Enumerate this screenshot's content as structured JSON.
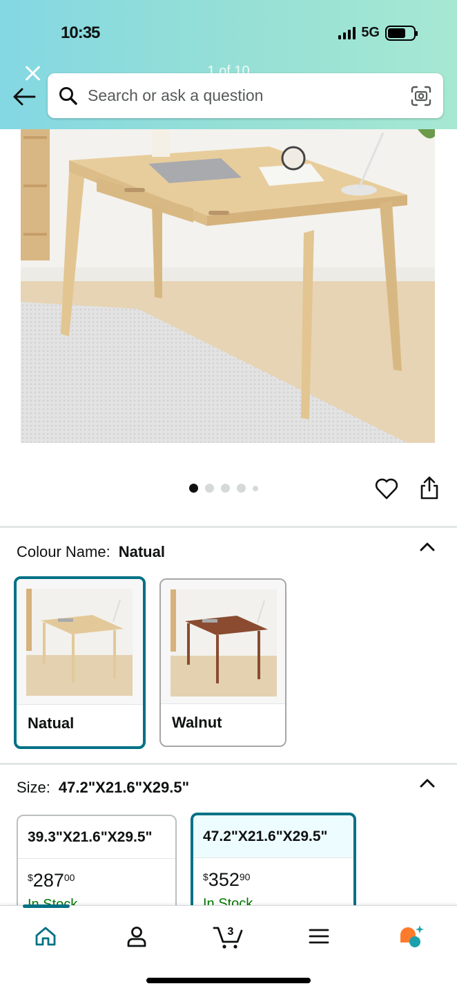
{
  "status_bar": {
    "time": "10:35",
    "network": "5G"
  },
  "header": {
    "image_counter": "1 of 10",
    "search_placeholder": "Search or ask a question"
  },
  "gallery": {
    "total_dots": 5,
    "active_index": 0
  },
  "colour": {
    "label": "Colour Name:",
    "selected": "Natual",
    "options": [
      {
        "name": "Natual",
        "selected": true,
        "wood_color": "#e3c99a"
      },
      {
        "name": "Walnut",
        "selected": false,
        "wood_color": "#8a4b30"
      }
    ]
  },
  "size": {
    "label": "Size:",
    "selected": "47.2\"X21.6\"X29.5\"",
    "options": [
      {
        "dimensions": "39.3\"X21.6\"X29.5\"",
        "price_symbol": "$",
        "price_whole": "287",
        "price_fraction": "00",
        "stock": "In Stock",
        "selected": false
      },
      {
        "dimensions": "47.2\"X21.6\"X29.5\"",
        "price_symbol": "$",
        "price_whole": "352",
        "price_fraction": "90",
        "stock": "In Stock",
        "selected": true
      }
    ]
  },
  "bottom_nav": {
    "items": [
      "home-icon",
      "account-icon",
      "cart-icon",
      "menu-icon",
      "rufus-assistant-icon"
    ],
    "cart_count": "3",
    "active": "home"
  },
  "colors": {
    "accent": "#007185",
    "in_stock": "#007600",
    "text": "#0f1111",
    "assistant_orange": "#ff7b2c",
    "assistant_teal": "#1ba1ae"
  }
}
